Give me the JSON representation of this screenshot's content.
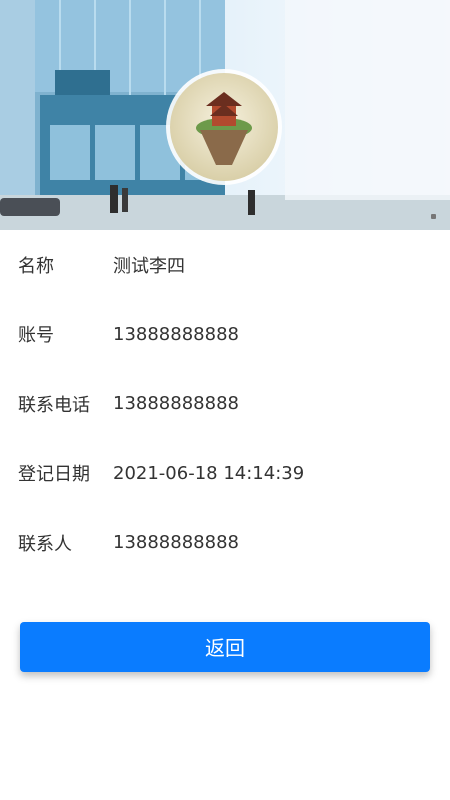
{
  "banner": {
    "image_alt": "headquarters building with floating island logo"
  },
  "fields": [
    {
      "label": "名称",
      "value": "测试李四"
    },
    {
      "label": "账号",
      "value": "13888888888"
    },
    {
      "label": "联系电话",
      "value": "13888888888"
    },
    {
      "label": "登记日期",
      "value": "2021-06-18 14:14:39"
    },
    {
      "label": "联系人",
      "value": "13888888888"
    }
  ],
  "actions": {
    "back_label": "返回"
  },
  "colors": {
    "primary": "#0a7cff",
    "text": "#333333"
  }
}
